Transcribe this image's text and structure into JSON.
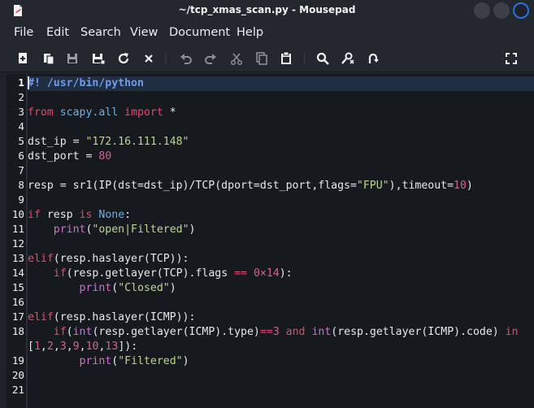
{
  "window": {
    "title": "~/tcp_xmas_scan.py - Mousepad",
    "app_icon": "document-icon"
  },
  "menu": [
    "File",
    "Edit",
    "Search",
    "View",
    "Document",
    "Help"
  ],
  "toolbar": [
    "new-document-icon",
    "open-icon",
    "save-icon",
    "save-as-icon",
    "reload-icon",
    "close-icon",
    "undo-icon",
    "redo-icon",
    "cut-icon",
    "copy-icon",
    "paste-icon",
    "find-icon",
    "find-replace-icon",
    "goto-line-icon",
    "fullscreen-icon"
  ],
  "colors": {
    "keyword": "#e6476c",
    "comment": "#6f9bf0",
    "string": "#b9d68f",
    "number": "#d1638e",
    "builtin": "#d26dd0"
  },
  "editor": {
    "line_numbers": [
      "1",
      "2",
      "3",
      "4",
      "5",
      "6",
      "7",
      "8",
      "9",
      "10",
      "11",
      "12",
      "13",
      "14",
      "15",
      "16",
      "17",
      "18",
      "19",
      "20",
      "21"
    ],
    "lines": [
      [
        {
          "t": "#! /usr/bin/python",
          "c": "comment"
        }
      ],
      [],
      [
        {
          "t": "from",
          "c": "kw"
        },
        {
          "t": " "
        },
        {
          "t": "scapy.all",
          "c": "mod"
        },
        {
          "t": " "
        },
        {
          "t": "import",
          "c": "kw"
        },
        {
          "t": " *"
        }
      ],
      [],
      [
        {
          "t": "dst_ip = "
        },
        {
          "t": "\"172.16.111.148\"",
          "c": "str"
        }
      ],
      [
        {
          "t": "dst_port = "
        },
        {
          "t": "80",
          "c": "num"
        }
      ],
      [],
      [
        {
          "t": "resp = sr1(IP(dst=dst_ip)/TCP(dport=dst_port,flags="
        },
        {
          "t": "\"FPU\"",
          "c": "str"
        },
        {
          "t": "),timeout="
        },
        {
          "t": "10",
          "c": "num"
        },
        {
          "t": ")"
        }
      ],
      [],
      [
        {
          "t": "if",
          "c": "kw"
        },
        {
          "t": " resp "
        },
        {
          "t": "is",
          "c": "kw"
        },
        {
          "t": " "
        },
        {
          "t": "None",
          "c": "mod"
        },
        {
          "t": ":"
        }
      ],
      [
        {
          "t": "    "
        },
        {
          "t": "print",
          "c": "func"
        },
        {
          "t": "("
        },
        {
          "t": "\"open|Filtered\"",
          "c": "str"
        },
        {
          "t": ")"
        }
      ],
      [],
      [
        {
          "t": "elif",
          "c": "kw"
        },
        {
          "t": "(resp.haslayer(TCP)):"
        }
      ],
      [
        {
          "t": "    "
        },
        {
          "t": "if",
          "c": "kw"
        },
        {
          "t": "(resp.getlayer(TCP).flags "
        },
        {
          "t": "==",
          "c": "cmp"
        },
        {
          "t": " "
        },
        {
          "t": "0×14",
          "c": "num"
        },
        {
          "t": "):"
        }
      ],
      [
        {
          "t": "        "
        },
        {
          "t": "print",
          "c": "func"
        },
        {
          "t": "("
        },
        {
          "t": "\"Closed\"",
          "c": "str"
        },
        {
          "t": ")"
        }
      ],
      [],
      [
        {
          "t": "elif",
          "c": "kw"
        },
        {
          "t": "(resp.haslayer(ICMP)):"
        }
      ],
      [
        {
          "t": "    "
        },
        {
          "t": "if",
          "c": "kw"
        },
        {
          "t": "("
        },
        {
          "t": "int",
          "c": "func"
        },
        {
          "t": "(resp.getlayer(ICMP).type)"
        },
        {
          "t": "==",
          "c": "cmp"
        },
        {
          "t": "3",
          "c": "num"
        },
        {
          "t": " "
        },
        {
          "t": "and",
          "c": "kw"
        },
        {
          "t": " "
        },
        {
          "t": "int",
          "c": "func"
        },
        {
          "t": "(resp.getlayer(ICMP).code) "
        },
        {
          "t": "in",
          "c": "kw"
        }
      ],
      [
        {
          "t": "["
        },
        {
          "t": "1",
          "c": "num"
        },
        {
          "t": ","
        },
        {
          "t": "2",
          "c": "num"
        },
        {
          "t": ","
        },
        {
          "t": "3",
          "c": "num"
        },
        {
          "t": ","
        },
        {
          "t": "9",
          "c": "num"
        },
        {
          "t": ","
        },
        {
          "t": "10",
          "c": "num"
        },
        {
          "t": ","
        },
        {
          "t": "13",
          "c": "num"
        },
        {
          "t": "]):"
        }
      ],
      [
        {
          "t": "        "
        },
        {
          "t": "print",
          "c": "func"
        },
        {
          "t": "("
        },
        {
          "t": "\"Filtered\"",
          "c": "str"
        },
        {
          "t": ")"
        }
      ],
      [],
      []
    ]
  }
}
